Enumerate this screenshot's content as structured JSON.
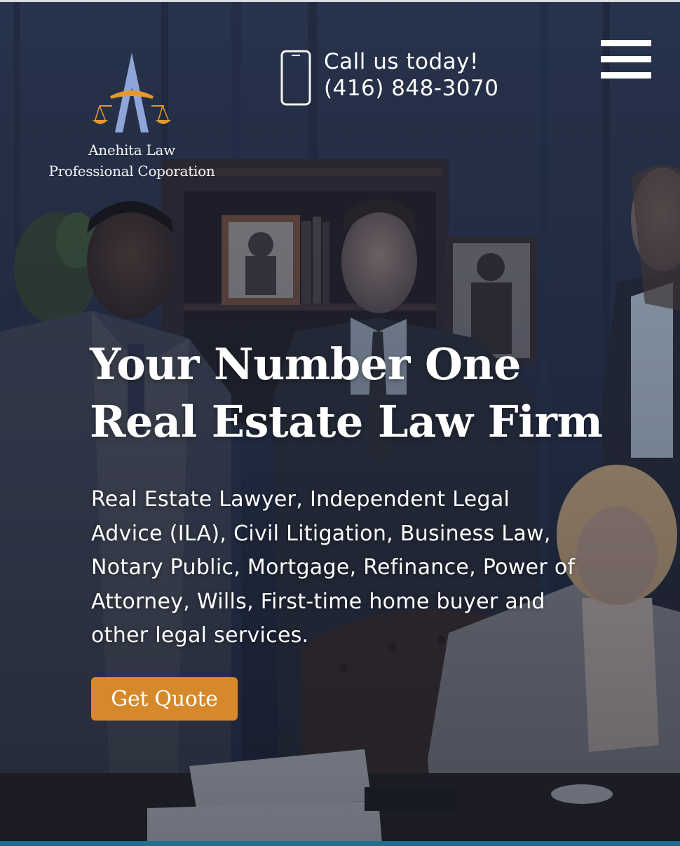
{
  "brand": {
    "name_line1": "Anehita Law",
    "name_line2": "Professional Coporation",
    "logo_icon": "scales-of-justice-a-logo",
    "colors": {
      "logo_blue": "#8fa5d8",
      "logo_gold": "#e39a2c"
    }
  },
  "contact": {
    "cta_line": "Call us today!",
    "phone": "(416) 848-3070",
    "icon": "smartphone-icon"
  },
  "nav": {
    "menu_icon": "hamburger-menu-icon"
  },
  "hero": {
    "title_line1": "Your Number One",
    "title_line2": "Real Estate Law Firm",
    "description": "Real Estate Lawyer, Independent Legal Advice (ILA), Civil Litigation, Business Law, Notary Public, Mortgage, Refinance, Power of Attorney, Wills, First-time home buyer and other legal services.",
    "cta_label": "Get Quote",
    "background": "team-of-lawyers-photo"
  },
  "theme": {
    "accent": "#d5892b",
    "overlay": "#1c2334",
    "bottom_bar": "#1f6f93"
  }
}
